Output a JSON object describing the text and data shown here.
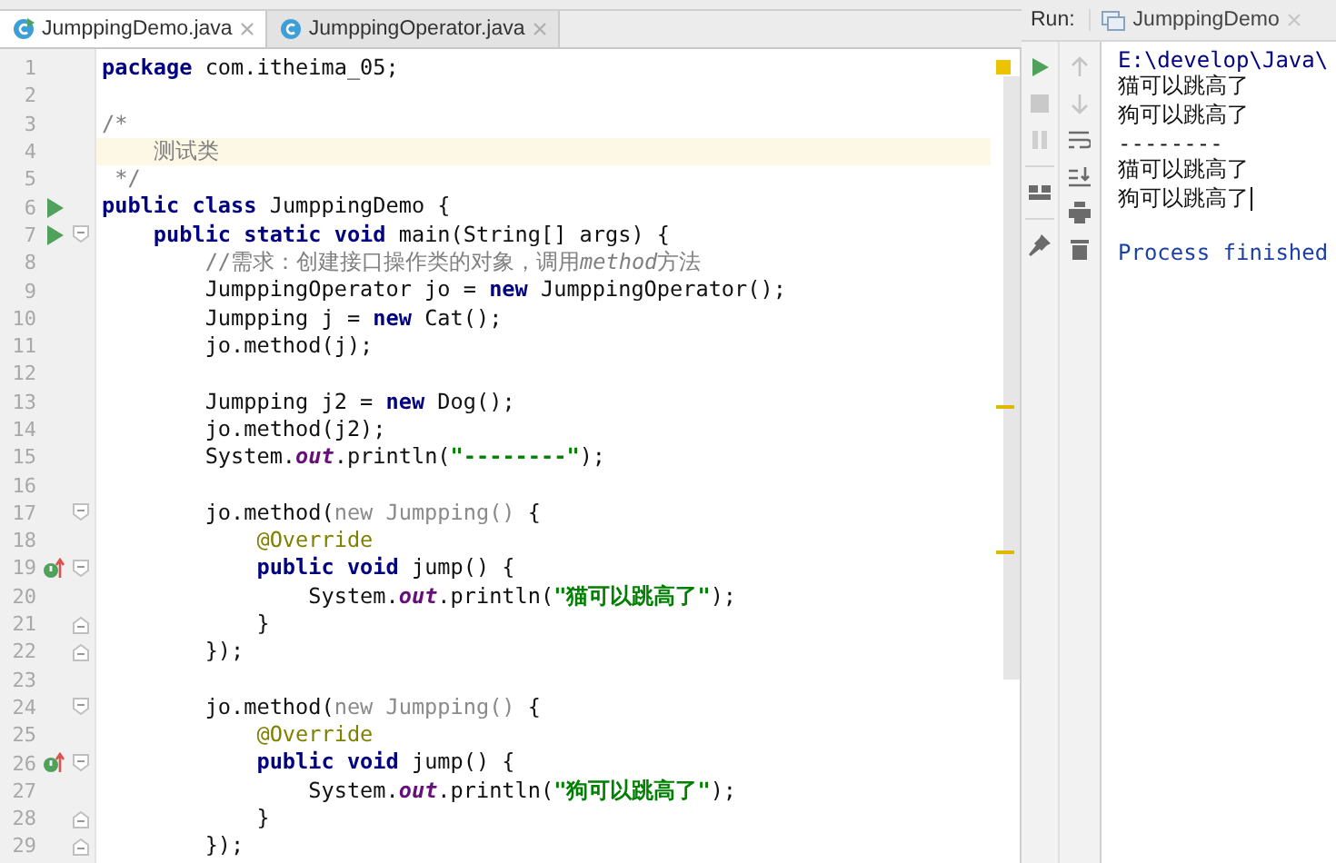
{
  "editor_tabs": [
    {
      "label": "JumppingDemo.java",
      "selected": true,
      "runnable": true
    },
    {
      "label": "JumppingOperator.java",
      "selected": false,
      "runnable": false
    }
  ],
  "code_lines": [
    {
      "number": "1",
      "tokens": [
        {
          "kind": "keyword",
          "text": "package"
        },
        {
          "kind": "plain",
          "text": " com.itheima_05;"
        }
      ]
    },
    {
      "number": "2"
    },
    {
      "number": "3",
      "tokens": [
        {
          "kind": "comment",
          "text": "/*"
        }
      ]
    },
    {
      "number": "4",
      "current": true,
      "tokens": [
        {
          "kind": "comment",
          "text": "    测试类"
        }
      ]
    },
    {
      "number": "5",
      "tokens": [
        {
          "kind": "comment",
          "text": " */"
        }
      ]
    },
    {
      "number": "6",
      "runnable": true,
      "tokens": [
        {
          "kind": "keyword",
          "text": "public class"
        },
        {
          "kind": "plain",
          "text": " JumppingDemo {"
        }
      ]
    },
    {
      "number": "7",
      "runnable": true,
      "fold_start": true,
      "tokens": [
        {
          "kind": "keyword",
          "text": "    public static void"
        },
        {
          "kind": "plain",
          "text": " main(String[] args) {"
        }
      ]
    },
    {
      "number": "8",
      "tokens": [
        {
          "kind": "comment",
          "text": "        //需求：创建接口操作类的对象，调用"
        },
        {
          "kind": "comment-italic",
          "text": "method"
        },
        {
          "kind": "comment",
          "text": "方法"
        }
      ]
    },
    {
      "number": "9",
      "tokens": [
        {
          "kind": "plain",
          "text": "        JumppingOperator jo = "
        },
        {
          "kind": "keyword",
          "text": "new"
        },
        {
          "kind": "plain",
          "text": " JumppingOperator();"
        }
      ]
    },
    {
      "number": "10",
      "tokens": [
        {
          "kind": "plain",
          "text": "        Jumpping j = "
        },
        {
          "kind": "keyword",
          "text": "new"
        },
        {
          "kind": "plain",
          "text": " Cat();"
        }
      ]
    },
    {
      "number": "11",
      "tokens": [
        {
          "kind": "plain",
          "text": "        jo.method(j);"
        }
      ]
    },
    {
      "number": "12"
    },
    {
      "number": "13",
      "tokens": [
        {
          "kind": "plain",
          "text": "        Jumpping j2 = "
        },
        {
          "kind": "keyword",
          "text": "new"
        },
        {
          "kind": "plain",
          "text": " Dog();"
        }
      ]
    },
    {
      "number": "14",
      "tokens": [
        {
          "kind": "plain",
          "text": "        jo.method(j2);"
        }
      ]
    },
    {
      "number": "15",
      "tokens": [
        {
          "kind": "plain",
          "text": "        System."
        },
        {
          "kind": "field",
          "text": "out"
        },
        {
          "kind": "plain",
          "text": ".println("
        },
        {
          "kind": "string",
          "text": "\"--------\""
        },
        {
          "kind": "plain",
          "text": ");"
        }
      ]
    },
    {
      "number": "16"
    },
    {
      "number": "17",
      "fold_start": true,
      "tokens": [
        {
          "kind": "plain",
          "text": "        jo.method("
        },
        {
          "kind": "dim",
          "text": "new Jumpping()"
        },
        {
          "kind": "plain",
          "text": " {"
        }
      ]
    },
    {
      "number": "18",
      "tokens": [
        {
          "kind": "annotation",
          "text": "            @Override"
        }
      ]
    },
    {
      "number": "19",
      "overrides": true,
      "fold_start": true,
      "tokens": [
        {
          "kind": "keyword",
          "text": "            public void"
        },
        {
          "kind": "plain",
          "text": " jump() {"
        }
      ]
    },
    {
      "number": "20",
      "tokens": [
        {
          "kind": "plain",
          "text": "                System."
        },
        {
          "kind": "field",
          "text": "out"
        },
        {
          "kind": "plain",
          "text": ".println("
        },
        {
          "kind": "string",
          "text": "\"猫可以跳高了\""
        },
        {
          "kind": "plain",
          "text": ");"
        }
      ]
    },
    {
      "number": "21",
      "fold_end": true,
      "tokens": [
        {
          "kind": "plain",
          "text": "            }"
        }
      ]
    },
    {
      "number": "22",
      "fold_end": true,
      "tokens": [
        {
          "kind": "plain",
          "text": "        });"
        }
      ]
    },
    {
      "number": "23"
    },
    {
      "number": "24",
      "fold_start": true,
      "tokens": [
        {
          "kind": "plain",
          "text": "        jo.method("
        },
        {
          "kind": "dim",
          "text": "new Jumpping()"
        },
        {
          "kind": "plain",
          "text": " {"
        }
      ]
    },
    {
      "number": "25",
      "tokens": [
        {
          "kind": "annotation",
          "text": "            @Override"
        }
      ]
    },
    {
      "number": "26",
      "overrides": true,
      "fold_start": true,
      "tokens": [
        {
          "kind": "keyword",
          "text": "            public void"
        },
        {
          "kind": "plain",
          "text": " jump() {"
        }
      ]
    },
    {
      "number": "27",
      "tokens": [
        {
          "kind": "plain",
          "text": "                System."
        },
        {
          "kind": "field",
          "text": "out"
        },
        {
          "kind": "plain",
          "text": ".println("
        },
        {
          "kind": "string",
          "text": "\"狗可以跳高了\""
        },
        {
          "kind": "plain",
          "text": ");"
        }
      ]
    },
    {
      "number": "28",
      "fold_end": true,
      "tokens": [
        {
          "kind": "plain",
          "text": "            }"
        }
      ]
    },
    {
      "number": "29",
      "fold_end": true,
      "tokens": [
        {
          "kind": "plain",
          "text": "        });"
        }
      ]
    }
  ],
  "run_panel": {
    "label": "Run:",
    "tab": {
      "label": "JumppingDemo"
    },
    "output": [
      {
        "kind": "path",
        "text": "E:\\develop\\Java\\"
      },
      {
        "kind": "stdout",
        "text": "猫可以跳高了"
      },
      {
        "kind": "stdout",
        "text": "狗可以跳高了"
      },
      {
        "kind": "stdout",
        "text": "--------"
      },
      {
        "kind": "stdout",
        "text": "猫可以跳高了"
      },
      {
        "kind": "stdout",
        "text": "狗可以跳高了",
        "cursor": true
      },
      {
        "kind": "exit",
        "text": "Process finished"
      }
    ]
  }
}
